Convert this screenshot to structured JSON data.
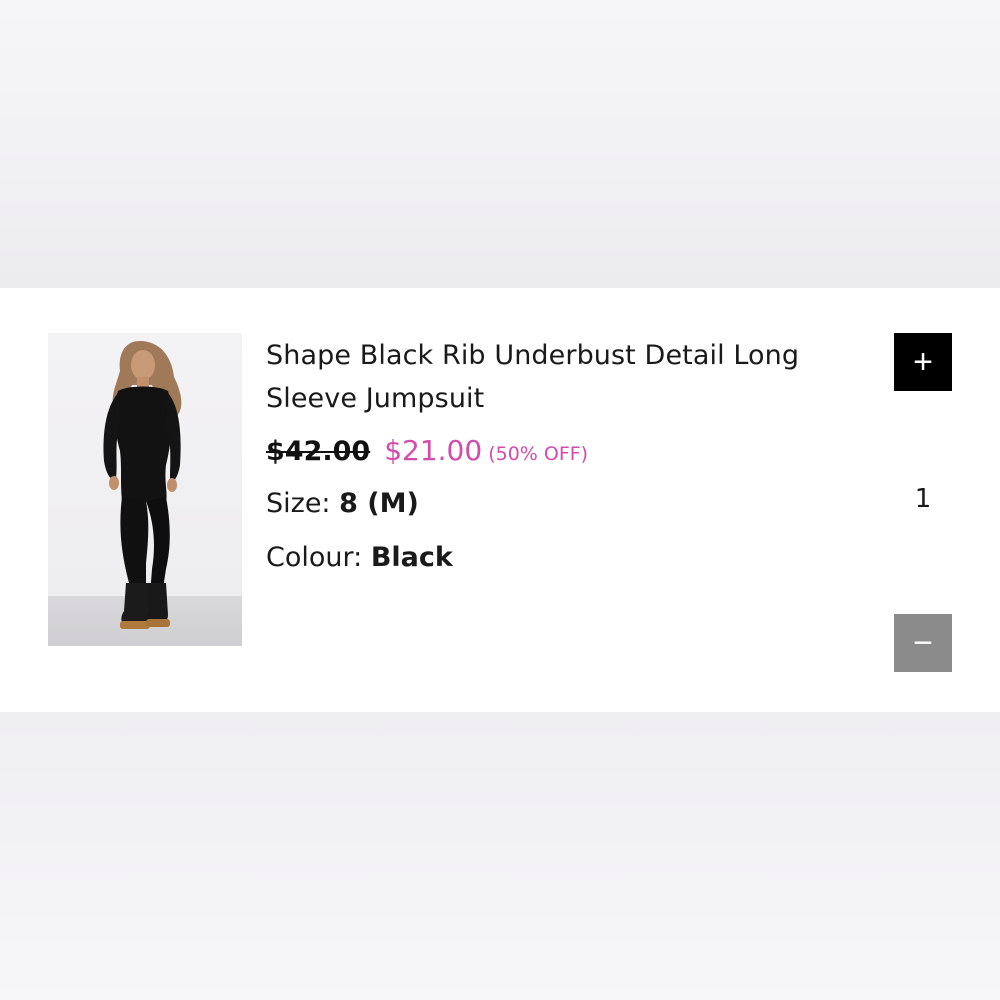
{
  "cart_item": {
    "image_alt": "Model wearing black long sleeve jumpsuit",
    "title_line1": "Shape Black Rib Underbust Detail Long",
    "title_line2": "Sleeve Jumpsuit",
    "price_original": "$42.00",
    "price_sale": "$21.00",
    "discount": "(50% OFF)",
    "size_label": "Size:",
    "size_value": "8 (M)",
    "colour_label": "Colour:",
    "colour_value": "Black",
    "quantity": "1",
    "plus_symbol": "+",
    "minus_symbol": "−"
  },
  "colors": {
    "sale_price": "#d24cae",
    "plus_button": "#000000",
    "minus_button": "#8b8b8b"
  },
  "icons": {
    "increase": "plus-icon",
    "decrease": "minus-icon"
  }
}
